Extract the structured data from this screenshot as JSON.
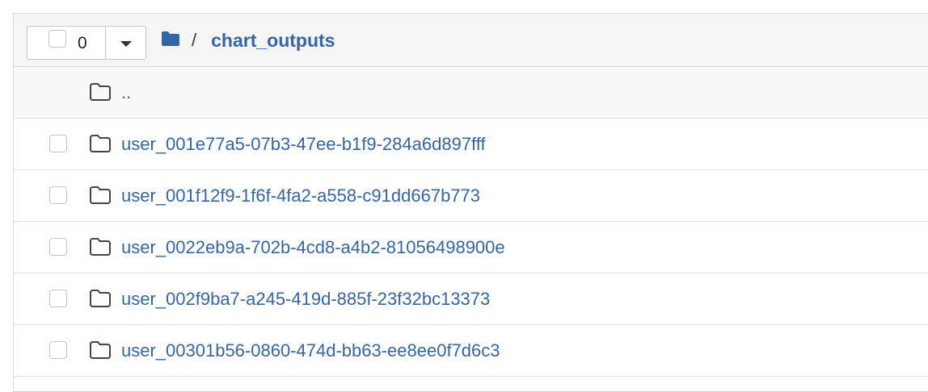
{
  "toolbar": {
    "selected_count": "0",
    "icons": {
      "checkbox": "checkbox-icon",
      "dropdown": "caret-down-icon",
      "folder": "folder-solid-icon"
    }
  },
  "breadcrumb": {
    "separator": "/",
    "current": "chart_outputs"
  },
  "parent_row": {
    "label": ".."
  },
  "rows": [
    {
      "name": "user_001e77a5-07b3-47ee-b1f9-284a6d897fff"
    },
    {
      "name": "user_001f12f9-1f6f-4fa2-a558-c91dd667b773"
    },
    {
      "name": "user_0022eb9a-702b-4cd8-a4b2-81056498900e"
    },
    {
      "name": "user_002f9ba7-a245-419d-885f-23f32bc13373"
    },
    {
      "name": "user_00301b56-0860-474d-bb63-ee8ee0f7d6c3"
    }
  ],
  "colors": {
    "link": "#3465a4",
    "header_bg": "#f5f5f5",
    "border": "#d8d8d8"
  }
}
